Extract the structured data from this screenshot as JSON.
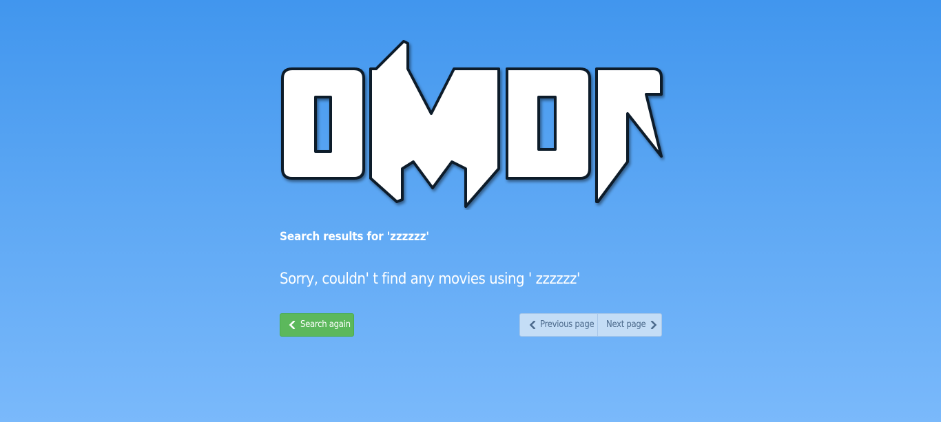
{
  "logo": {
    "text": "oMDr"
  },
  "results": {
    "heading": "Search results for 'zzzzzz'",
    "message": "Sorry, couldn' t find any movies using ' zzzzzz'"
  },
  "actions": {
    "search_again_label": "Search again",
    "previous_page_label": "Previous page",
    "next_page_label": "Next page"
  },
  "icons": {
    "search_again": "chevron-left-icon",
    "previous_page": "chevron-left-icon",
    "next_page": "chevron-right-icon"
  },
  "colors": {
    "background_top": "#4196ee",
    "background_bottom": "#7ab9fb",
    "success_button": "#5cb85c",
    "pager_button": "#c4ddf6",
    "pager_text": "#4c6a8c"
  }
}
